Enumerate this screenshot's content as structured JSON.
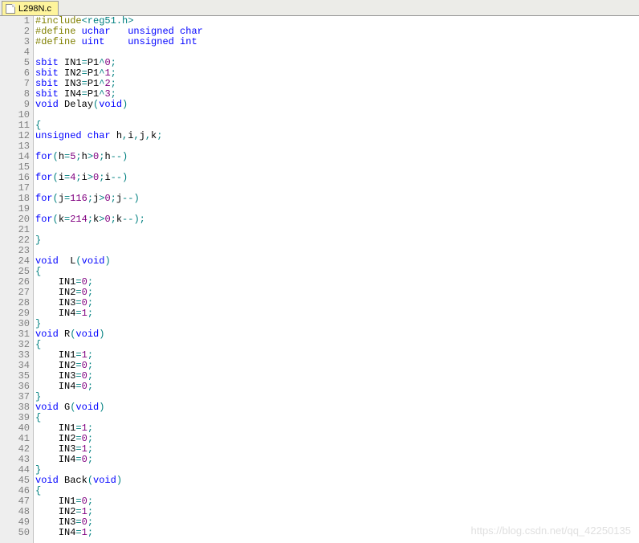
{
  "tab": {
    "filename": "L298N.c"
  },
  "watermark": "https://blog.csdn.net/qq_42250135",
  "code": {
    "lines": [
      {
        "n": 1,
        "tokens": [
          [
            "pp",
            "#include"
          ],
          [
            "str",
            "<reg51.h>"
          ]
        ]
      },
      {
        "n": 2,
        "tokens": [
          [
            "pp",
            "#define"
          ],
          [
            "",
            ""
          ],
          [
            "kw",
            " uchar   unsigned char"
          ]
        ]
      },
      {
        "n": 3,
        "tokens": [
          [
            "pp",
            "#define"
          ],
          [
            "",
            ""
          ],
          [
            "kw",
            " uint    unsigned int"
          ]
        ]
      },
      {
        "n": 4,
        "tokens": []
      },
      {
        "n": 5,
        "tokens": [
          [
            "kw",
            "sbit"
          ],
          [
            "",
            " IN1"
          ],
          [
            "op",
            "="
          ],
          [
            "",
            "P1"
          ],
          [
            "op",
            "^"
          ],
          [
            "num",
            "0"
          ],
          [
            "op",
            ";"
          ]
        ]
      },
      {
        "n": 6,
        "tokens": [
          [
            "kw",
            "sbit"
          ],
          [
            "",
            " IN2"
          ],
          [
            "op",
            "="
          ],
          [
            "",
            "P1"
          ],
          [
            "op",
            "^"
          ],
          [
            "num",
            "1"
          ],
          [
            "op",
            ";"
          ]
        ]
      },
      {
        "n": 7,
        "tokens": [
          [
            "kw",
            "sbit"
          ],
          [
            "",
            " IN3"
          ],
          [
            "op",
            "="
          ],
          [
            "",
            "P1"
          ],
          [
            "op",
            "^"
          ],
          [
            "num",
            "2"
          ],
          [
            "op",
            ";"
          ]
        ]
      },
      {
        "n": 8,
        "tokens": [
          [
            "kw",
            "sbit"
          ],
          [
            "",
            " IN4"
          ],
          [
            "op",
            "="
          ],
          [
            "",
            "P1"
          ],
          [
            "op",
            "^"
          ],
          [
            "num",
            "3"
          ],
          [
            "op",
            ";"
          ]
        ]
      },
      {
        "n": 9,
        "tokens": [
          [
            "kw",
            "void"
          ],
          [
            "",
            " Delay"
          ],
          [
            "op",
            "("
          ],
          [
            "kw",
            "void"
          ],
          [
            "op",
            ")"
          ]
        ]
      },
      {
        "n": 10,
        "tokens": []
      },
      {
        "n": 11,
        "tokens": [
          [
            "op",
            "{"
          ]
        ]
      },
      {
        "n": 12,
        "tokens": [
          [
            "kw",
            "unsigned char"
          ],
          [
            "",
            " h"
          ],
          [
            "op",
            ","
          ],
          [
            "",
            "i"
          ],
          [
            "op",
            ","
          ],
          [
            "",
            "j"
          ],
          [
            "op",
            ","
          ],
          [
            "",
            "k"
          ],
          [
            "op",
            ";"
          ]
        ]
      },
      {
        "n": 13,
        "tokens": []
      },
      {
        "n": 14,
        "tokens": [
          [
            "kw",
            "for"
          ],
          [
            "op",
            "("
          ],
          [
            "",
            "h"
          ],
          [
            "op",
            "="
          ],
          [
            "num",
            "5"
          ],
          [
            "op",
            ";"
          ],
          [
            "",
            "h"
          ],
          [
            "op",
            ">"
          ],
          [
            "num",
            "0"
          ],
          [
            "op",
            ";"
          ],
          [
            "",
            "h"
          ],
          [
            "op",
            "--)"
          ]
        ]
      },
      {
        "n": 15,
        "tokens": []
      },
      {
        "n": 16,
        "tokens": [
          [
            "kw",
            "for"
          ],
          [
            "op",
            "("
          ],
          [
            "",
            "i"
          ],
          [
            "op",
            "="
          ],
          [
            "num",
            "4"
          ],
          [
            "op",
            ";"
          ],
          [
            "",
            "i"
          ],
          [
            "op",
            ">"
          ],
          [
            "num",
            "0"
          ],
          [
            "op",
            ";"
          ],
          [
            "",
            "i"
          ],
          [
            "op",
            "--)"
          ]
        ]
      },
      {
        "n": 17,
        "tokens": []
      },
      {
        "n": 18,
        "tokens": [
          [
            "kw",
            "for"
          ],
          [
            "op",
            "("
          ],
          [
            "",
            "j"
          ],
          [
            "op",
            "="
          ],
          [
            "num",
            "116"
          ],
          [
            "op",
            ";"
          ],
          [
            "",
            "j"
          ],
          [
            "op",
            ">"
          ],
          [
            "num",
            "0"
          ],
          [
            "op",
            ";"
          ],
          [
            "",
            "j"
          ],
          [
            "op",
            "--)"
          ]
        ]
      },
      {
        "n": 19,
        "tokens": []
      },
      {
        "n": 20,
        "tokens": [
          [
            "kw",
            "for"
          ],
          [
            "op",
            "("
          ],
          [
            "",
            "k"
          ],
          [
            "op",
            "="
          ],
          [
            "num",
            "214"
          ],
          [
            "op",
            ";"
          ],
          [
            "",
            "k"
          ],
          [
            "op",
            ">"
          ],
          [
            "num",
            "0"
          ],
          [
            "op",
            ";"
          ],
          [
            "",
            "k"
          ],
          [
            "op",
            "--);"
          ]
        ]
      },
      {
        "n": 21,
        "tokens": []
      },
      {
        "n": 22,
        "tokens": [
          [
            "op",
            "}"
          ]
        ]
      },
      {
        "n": 23,
        "tokens": []
      },
      {
        "n": 24,
        "tokens": [
          [
            "kw",
            "void"
          ],
          [
            "",
            "  L"
          ],
          [
            "op",
            "("
          ],
          [
            "kw",
            "void"
          ],
          [
            "op",
            ")"
          ]
        ]
      },
      {
        "n": 25,
        "tokens": [
          [
            "op",
            "{"
          ]
        ]
      },
      {
        "n": 26,
        "tokens": [
          [
            "",
            "    IN1"
          ],
          [
            "op",
            "="
          ],
          [
            "num",
            "0"
          ],
          [
            "op",
            ";"
          ]
        ]
      },
      {
        "n": 27,
        "tokens": [
          [
            "",
            "    IN2"
          ],
          [
            "op",
            "="
          ],
          [
            "num",
            "0"
          ],
          [
            "op",
            ";"
          ]
        ]
      },
      {
        "n": 28,
        "tokens": [
          [
            "",
            "    IN3"
          ],
          [
            "op",
            "="
          ],
          [
            "num",
            "0"
          ],
          [
            "op",
            ";"
          ]
        ]
      },
      {
        "n": 29,
        "tokens": [
          [
            "",
            "    IN4"
          ],
          [
            "op",
            "="
          ],
          [
            "num",
            "1"
          ],
          [
            "op",
            ";"
          ]
        ]
      },
      {
        "n": 30,
        "tokens": [
          [
            "op",
            "}"
          ]
        ]
      },
      {
        "n": 31,
        "tokens": [
          [
            "kw",
            "void"
          ],
          [
            "",
            " R"
          ],
          [
            "op",
            "("
          ],
          [
            "kw",
            "void"
          ],
          [
            "op",
            ")"
          ]
        ]
      },
      {
        "n": 32,
        "tokens": [
          [
            "op",
            "{"
          ]
        ]
      },
      {
        "n": 33,
        "tokens": [
          [
            "",
            "    IN1"
          ],
          [
            "op",
            "="
          ],
          [
            "num",
            "1"
          ],
          [
            "op",
            ";"
          ]
        ]
      },
      {
        "n": 34,
        "tokens": [
          [
            "",
            "    IN2"
          ],
          [
            "op",
            "="
          ],
          [
            "num",
            "0"
          ],
          [
            "op",
            ";"
          ]
        ]
      },
      {
        "n": 35,
        "tokens": [
          [
            "",
            "    IN3"
          ],
          [
            "op",
            "="
          ],
          [
            "num",
            "0"
          ],
          [
            "op",
            ";"
          ]
        ]
      },
      {
        "n": 36,
        "tokens": [
          [
            "",
            "    IN4"
          ],
          [
            "op",
            "="
          ],
          [
            "num",
            "0"
          ],
          [
            "op",
            ";"
          ]
        ]
      },
      {
        "n": 37,
        "tokens": [
          [
            "op",
            "}"
          ]
        ]
      },
      {
        "n": 38,
        "tokens": [
          [
            "kw",
            "void"
          ],
          [
            "",
            " G"
          ],
          [
            "op",
            "("
          ],
          [
            "kw",
            "void"
          ],
          [
            "op",
            ")"
          ]
        ]
      },
      {
        "n": 39,
        "tokens": [
          [
            "op",
            "{"
          ]
        ]
      },
      {
        "n": 40,
        "tokens": [
          [
            "",
            "    IN1"
          ],
          [
            "op",
            "="
          ],
          [
            "num",
            "1"
          ],
          [
            "op",
            ";"
          ]
        ]
      },
      {
        "n": 41,
        "tokens": [
          [
            "",
            "    IN2"
          ],
          [
            "op",
            "="
          ],
          [
            "num",
            "0"
          ],
          [
            "op",
            ";"
          ]
        ]
      },
      {
        "n": 42,
        "tokens": [
          [
            "",
            "    IN3"
          ],
          [
            "op",
            "="
          ],
          [
            "num",
            "1"
          ],
          [
            "op",
            ";"
          ]
        ]
      },
      {
        "n": 43,
        "tokens": [
          [
            "",
            "    IN4"
          ],
          [
            "op",
            "="
          ],
          [
            "num",
            "0"
          ],
          [
            "op",
            ";"
          ]
        ]
      },
      {
        "n": 44,
        "tokens": [
          [
            "op",
            "}"
          ]
        ]
      },
      {
        "n": 45,
        "tokens": [
          [
            "kw",
            "void"
          ],
          [
            "",
            " Back"
          ],
          [
            "op",
            "("
          ],
          [
            "kw",
            "void"
          ],
          [
            "op",
            ")"
          ]
        ]
      },
      {
        "n": 46,
        "tokens": [
          [
            "op",
            "{"
          ]
        ]
      },
      {
        "n": 47,
        "tokens": [
          [
            "",
            "    IN1"
          ],
          [
            "op",
            "="
          ],
          [
            "num",
            "0"
          ],
          [
            "op",
            ";"
          ]
        ]
      },
      {
        "n": 48,
        "tokens": [
          [
            "",
            "    IN2"
          ],
          [
            "op",
            "="
          ],
          [
            "num",
            "1"
          ],
          [
            "op",
            ";"
          ]
        ]
      },
      {
        "n": 49,
        "tokens": [
          [
            "",
            "    IN3"
          ],
          [
            "op",
            "="
          ],
          [
            "num",
            "0"
          ],
          [
            "op",
            ";"
          ]
        ]
      },
      {
        "n": 50,
        "tokens": [
          [
            "",
            "    IN4"
          ],
          [
            "op",
            "="
          ],
          [
            "num",
            "1"
          ],
          [
            "op",
            ";"
          ]
        ]
      }
    ]
  }
}
